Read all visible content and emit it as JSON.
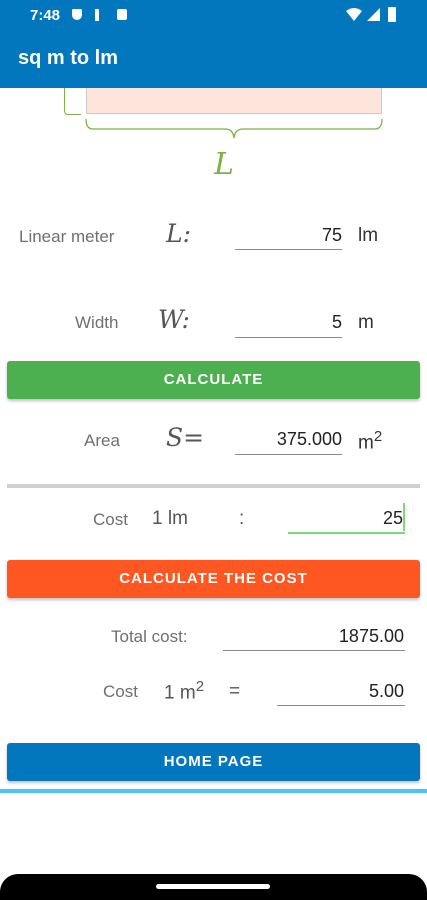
{
  "status_bar": {
    "time": "7:48",
    "icons": [
      "shield-icon",
      "usb-icon",
      "sd-card-icon",
      "wifi-icon",
      "signal-icon",
      "battery-icon"
    ]
  },
  "app_bar": {
    "title": "sq m to lm"
  },
  "diagram": {
    "dimension_label": "L"
  },
  "linear_meter": {
    "label": "Linear meter",
    "symbol": "L:",
    "value": "75",
    "unit": "lm"
  },
  "width": {
    "label": "Width",
    "symbol": "W:",
    "value": "5",
    "unit": "m"
  },
  "calculate_button": {
    "label": "CALCULATE",
    "color": "#4caf50"
  },
  "area": {
    "label": "Area",
    "symbol": "S=",
    "value": "375.000",
    "unit": "m",
    "unit_exp": "2"
  },
  "cost": {
    "label": "Cost",
    "per_unit": "1 lm",
    "colon": ":",
    "value": "25"
  },
  "calculate_cost_button": {
    "label": "CALCULATE THE COST",
    "color": "#ff5722"
  },
  "total_cost": {
    "label": "Total cost:",
    "value": "1875.00"
  },
  "cost_per_sqm": {
    "label": "Cost",
    "per_unit": "1 m",
    "per_unit_exp": "2",
    "equals": "=",
    "value": "5.00"
  },
  "home_button": {
    "label": "HOME PAGE",
    "color": "#0277bd"
  },
  "colors": {
    "primary": "#0277bd",
    "accent_green": "#7cb342",
    "divider_blue": "#4fc3f7"
  }
}
